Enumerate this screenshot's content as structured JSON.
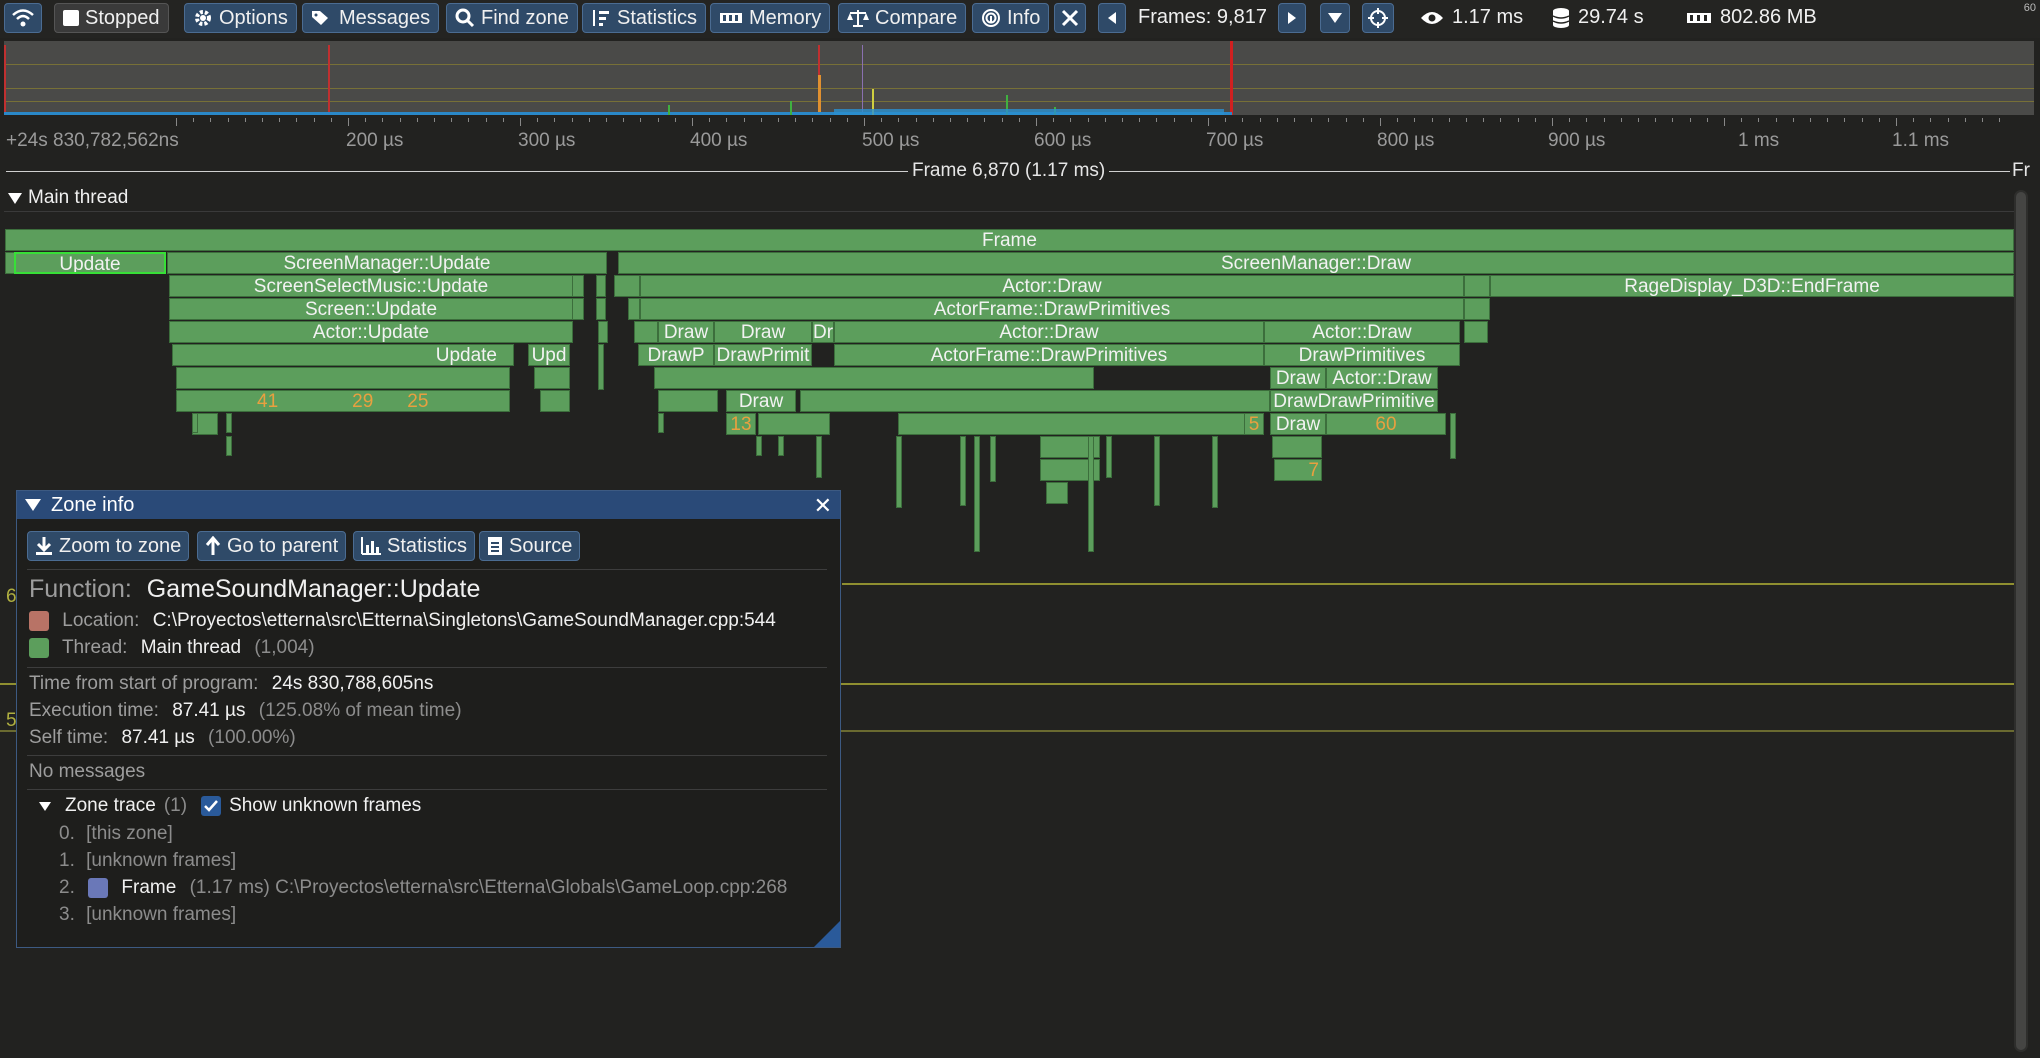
{
  "toolbar": {
    "connection_icon": "wifi-icon",
    "stopped_label": "Stopped",
    "options_label": "Options",
    "messages_label": "Messages",
    "find_zone_label": "Find zone",
    "statistics_label": "Statistics",
    "memory_label": "Memory",
    "compare_label": "Compare",
    "info_label": "Info",
    "frames_label": "Frames: 9,817",
    "view_time": "1.17 ms",
    "total_time": "29.74 s",
    "memory_usage": "802.86 MB",
    "corner_number": "60"
  },
  "ruler": {
    "labels": [
      "+24s 830,782,562ns",
      "200 µs",
      "300 µs",
      "400 µs",
      "500 µs",
      "600 µs",
      "700 µs",
      "800 µs",
      "900 µs",
      "1 ms",
      "1.1 ms"
    ]
  },
  "frame_bar": {
    "label": "Frame 6,870 (1.17 ms)",
    "next_label": "Fr"
  },
  "thread": {
    "name": "Main thread"
  },
  "zones": {
    "frame": "Frame",
    "update": "Update",
    "screen_manager_update": "ScreenManager::Update",
    "screen_manager_draw": "ScreenManager::Draw",
    "screen_select_music_update": "ScreenSelectMusic::Update",
    "actor_draw_main": "Actor::Draw",
    "rage_display_end_frame": "RageDisplay_D3D::EndFrame",
    "screen_update": "Screen::Update",
    "actorframe_draw_primitives_main": "ActorFrame::DrawPrimitives",
    "actor_update": "Actor::Update",
    "draw_a": "Draw",
    "draw_b": "Draw",
    "draw_c": "Dr",
    "actor_draw_mid": "Actor::Draw",
    "actor_draw_right": "Actor::Draw",
    "update_small": "Update",
    "upd_small": "Upd",
    "drawp_a": "DrawP",
    "drawprimit": "DrawPrimit",
    "actorframe_draw_primitives_mid": "ActorFrame::DrawPrimitives",
    "draw_primitives_right": "DrawPrimitives",
    "draw_r": "Draw",
    "actor_draw_r": "Actor::Draw",
    "draw_draw_primitives": "DrawDrawPrimitive",
    "draw_left": "Draw",
    "draw_left2": "Draw",
    "count_41": "41",
    "count_29": "29",
    "count_25": "25",
    "count_13": "13",
    "count_60": "60",
    "count_5": "5",
    "count_7": "7"
  },
  "zone_info": {
    "title": "Zone info",
    "buttons": {
      "zoom_to_zone": "Zoom to zone",
      "go_to_parent": "Go to parent",
      "statistics": "Statistics",
      "source": "Source"
    },
    "function_label": "Function:",
    "function_name": "GameSoundManager::Update",
    "location_label": "Location:",
    "location_value": "C:\\Proyectos\\etterna\\src\\Etterna\\Singletons\\GameSoundManager.cpp:544",
    "location_color": "#b87366",
    "thread_label": "Thread:",
    "thread_value": "Main thread",
    "thread_count": "(1,004)",
    "thread_color": "#5c9e5c",
    "time_from_start_label": "Time from start of program:",
    "time_from_start_value": "24s 830,788,605ns",
    "execution_time_label": "Execution time:",
    "execution_time_value": "87.41 µs",
    "execution_time_note": "(125.08% of mean time)",
    "self_time_label": "Self time:",
    "self_time_value": "87.41 µs",
    "self_time_note": "(100.00%)",
    "messages_text": "No messages",
    "zone_trace_label": "Zone trace",
    "zone_trace_count": "(1)",
    "show_unknown_label": "Show unknown frames",
    "show_unknown_checked": true,
    "trace": [
      {
        "index": "0.",
        "text": "[this zone]"
      },
      {
        "index": "1.",
        "text": "[unknown frames]"
      },
      {
        "index": "2.",
        "name": "Frame",
        "time": "(1.17 ms)",
        "location": "C:\\Proyectos\\etterna\\src\\Etterna\\Globals\\GameLoop.cpp:268",
        "color": "#6a78b8"
      },
      {
        "index": "3.",
        "text": "[unknown frames]"
      }
    ]
  },
  "side_marks": [
    "6",
    "5"
  ]
}
